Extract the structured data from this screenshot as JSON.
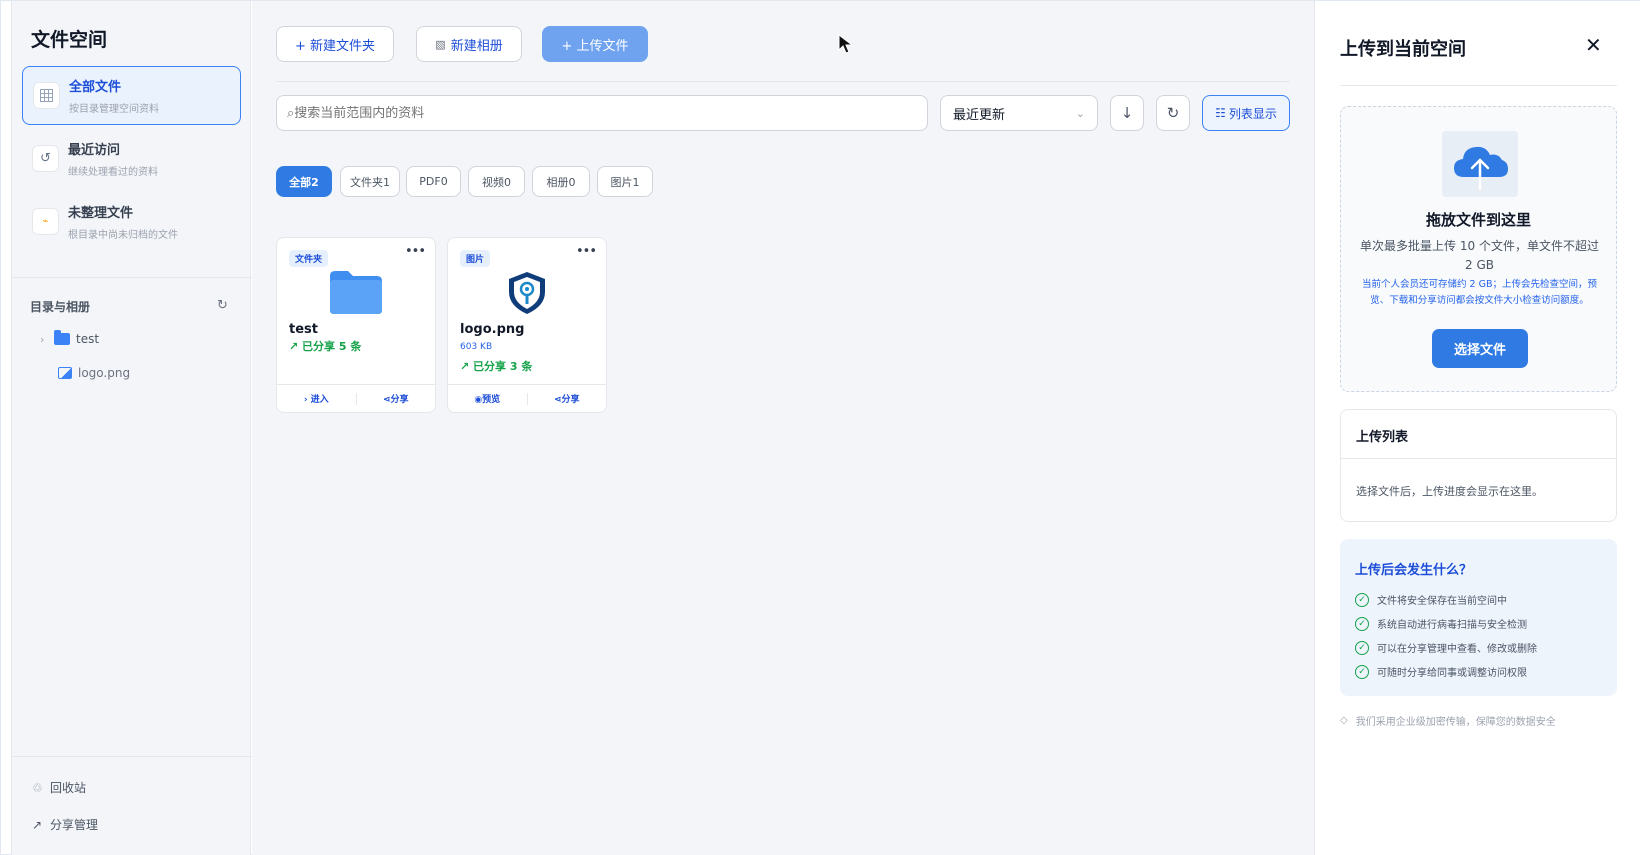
{
  "sidebar": {
    "title": "文件空间",
    "items": [
      {
        "label": "全部文件",
        "desc": "按目录管理空间资料",
        "icon": "grid-icon"
      },
      {
        "label": "最近访问",
        "desc": "继续处理看过的资料",
        "icon": "history-icon"
      },
      {
        "label": "未整理文件",
        "desc": "根目录中尚未归档的文件",
        "icon": "unsorted-icon"
      }
    ],
    "section_title": "目录与相册",
    "tree": [
      {
        "label": "test",
        "icon": "folder-icon"
      },
      {
        "label": "logo.png",
        "icon": "image-icon"
      }
    ],
    "bottom": [
      {
        "label": "回收站",
        "icon": "recycle-icon"
      },
      {
        "label": "分享管理",
        "icon": "share-arrow-icon"
      }
    ]
  },
  "toolbar": {
    "new_folder": "+ 新建文件夹",
    "new_album": "新建相册",
    "upload": "+ 上传文件",
    "search_placeholder": "⌕搜索当前范围内的资料",
    "sort_value": "最近更新",
    "view_label": "列表显示"
  },
  "filters": [
    "全部2",
    "文件夹1",
    "PDF0",
    "视频0",
    "相册0",
    "图片1"
  ],
  "cards": [
    {
      "tag": "文件夹",
      "name": "test",
      "size": "",
      "share": "↗ 已分享 5 条",
      "actions": [
        "进入",
        "分享"
      ]
    },
    {
      "tag": "图片",
      "name": "logo.png",
      "size": "603 KB",
      "share": "↗ 已分享 3 条",
      "actions": [
        "预览",
        "分享"
      ]
    }
  ],
  "panel": {
    "title": "上传到当前空间",
    "drop_title": "拖放文件到这里",
    "drop_desc": "单次最多批量上传 10 个文件，单文件不超过 2 GB",
    "drop_note": "当前个人会员还可存储约 2 GB；上传会先检查空间，预览、下载和分享访问都会按文件大小检查访问额度。",
    "choose_button": "选择文件",
    "list_title": "上传列表",
    "list_empty": "选择文件后，上传进度会显示在这里。",
    "info_title": "上传后会发生什么？",
    "info_items": [
      "文件将安全保存在当前空间中",
      "系统自动进行病毒扫描与安全检测",
      "可以在分享管理中查看、修改或删除",
      "可随时分享给同事或调整访问权限"
    ],
    "footer": "我们采用企业级加密传输，保障您的数据安全"
  },
  "colors": {
    "primary": "#2f7be3",
    "success": "#16a34a",
    "sidebar_bg": "#f3f5f8"
  }
}
